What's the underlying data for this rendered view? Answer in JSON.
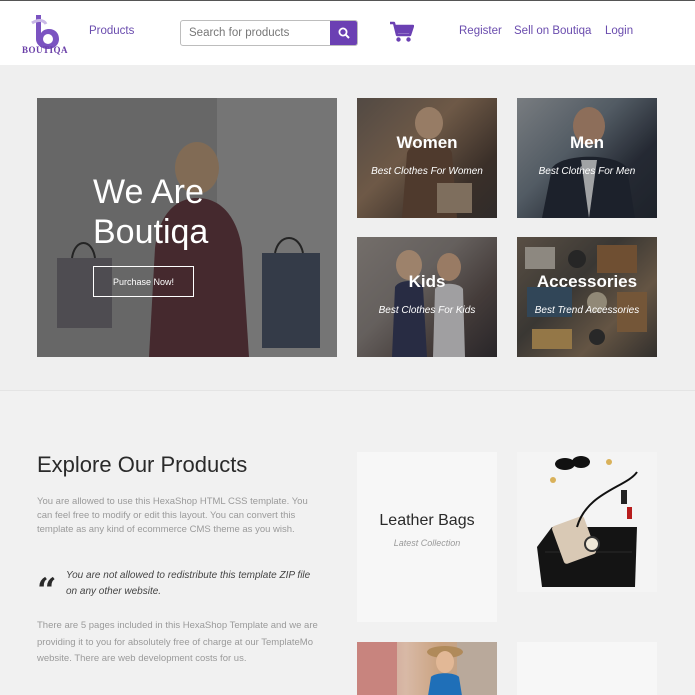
{
  "header": {
    "logo_text": "BOUTIQA",
    "nav_products": "Products",
    "search_placeholder": "Search for products",
    "search_icon": "search-icon",
    "cart_icon": "cart-icon",
    "register": "Register",
    "sell": "Sell on Boutiqa",
    "login": "Login"
  },
  "hero": {
    "title_line1": "We Are",
    "title_line2": "Boutiqa",
    "button": "Purchase Now!"
  },
  "categories": [
    {
      "title": "Women",
      "subtitle": "Best Clothes For Women"
    },
    {
      "title": "Men",
      "subtitle": "Best Clothes For Men"
    },
    {
      "title": "Kids",
      "subtitle": "Best Clothes For Kids"
    },
    {
      "title": "Accessories",
      "subtitle": "Best Trend Accessories"
    }
  ],
  "explore": {
    "title": "Explore Our Products",
    "paragraph1": "You are allowed to use this HexaShop HTML CSS template. You can feel free to modify or edit this layout. You can convert this template as any kind of ecommerce CMS theme as you wish.",
    "quote": "You are not allowed to redistribute this template ZIP file on any other website.",
    "paragraph2": "There are 5 pages included in this HexaShop Template and we are providing it to you for absolutely free of charge at our TemplateMo website. There are web development costs for us.",
    "tile_title": "Leather Bags",
    "tile_subtitle": "Latest Collection"
  },
  "colors": {
    "brand": "#6b40b3",
    "nav_text": "#6a4cae"
  }
}
